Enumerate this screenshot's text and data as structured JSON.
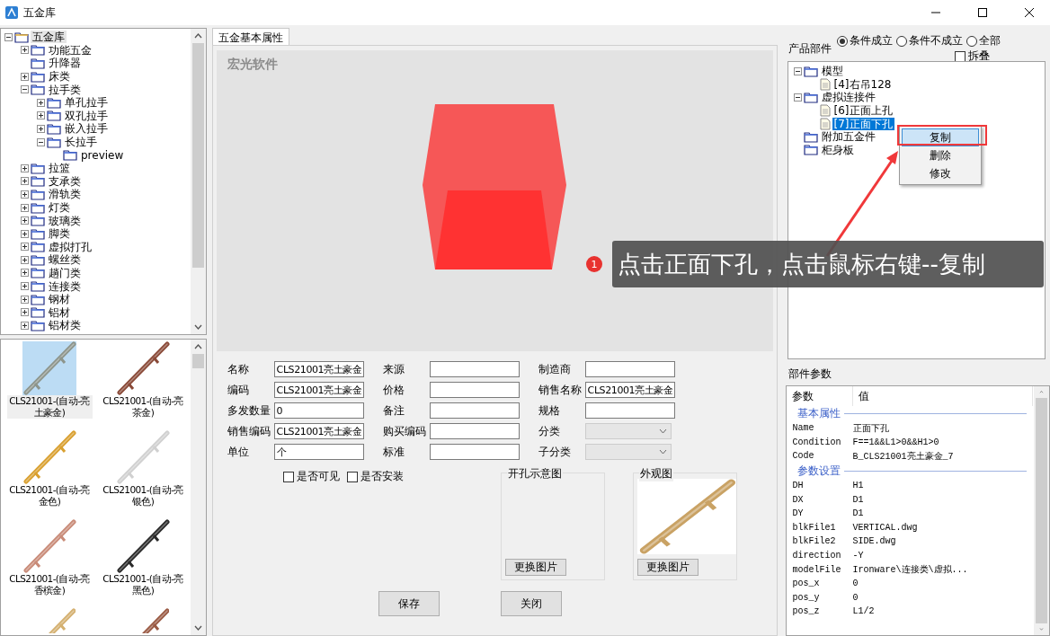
{
  "window": {
    "title": "五金库"
  },
  "category_tree": [
    {
      "label": "五金库",
      "kind": "open-folder",
      "expanded": true,
      "selected": true,
      "children": [
        {
          "label": "功能五金",
          "kind": "folder",
          "expanded": false,
          "selected": false
        },
        {
          "label": "升降器",
          "kind": "folder",
          "selected": false
        },
        {
          "label": "床类",
          "kind": "folder",
          "expanded": false,
          "selected": false
        },
        {
          "label": "拉手类",
          "kind": "folder",
          "expanded": true,
          "selected": false,
          "children": [
            {
              "label": "单孔拉手",
              "kind": "folder",
              "expanded": false,
              "selected": false
            },
            {
              "label": "双孔拉手",
              "kind": "folder",
              "expanded": false,
              "selected": false
            },
            {
              "label": "嵌入拉手",
              "kind": "folder",
              "expanded": false,
              "selected": false
            },
            {
              "label": "长拉手",
              "kind": "folder",
              "expanded": true,
              "selected": false,
              "children": [
                {
                  "label": "preview",
                  "kind": "folder",
                  "selected": false
                }
              ]
            }
          ]
        },
        {
          "label": "拉篮",
          "kind": "folder",
          "expanded": false,
          "selected": false
        },
        {
          "label": "支承类",
          "kind": "folder",
          "expanded": false,
          "selected": false
        },
        {
          "label": "滑轨类",
          "kind": "folder",
          "expanded": false,
          "selected": false
        },
        {
          "label": "灯类",
          "kind": "folder",
          "expanded": false,
          "selected": false
        },
        {
          "label": "玻璃类",
          "kind": "folder",
          "expanded": false,
          "selected": false
        },
        {
          "label": "脚类",
          "kind": "folder",
          "expanded": false,
          "selected": false
        },
        {
          "label": "虚拟打孔",
          "kind": "folder",
          "expanded": false,
          "selected": false
        },
        {
          "label": "螺丝类",
          "kind": "folder",
          "expanded": false,
          "selected": false
        },
        {
          "label": "趟门类",
          "kind": "folder",
          "expanded": false,
          "selected": false
        },
        {
          "label": "连接类",
          "kind": "folder",
          "expanded": false,
          "selected": false
        },
        {
          "label": "钢材",
          "kind": "folder",
          "expanded": false,
          "selected": false
        },
        {
          "label": "铝材",
          "kind": "folder",
          "expanded": false,
          "selected": false
        },
        {
          "label": "铝材类",
          "kind": "folder",
          "expanded": false,
          "selected": false
        }
      ]
    }
  ],
  "gallery": [
    {
      "caption": "CLS21001-(自动-亮土豪金)",
      "color": "#8d958c",
      "selected": true
    },
    {
      "caption": "CLS21001-(自动-亮茶金)",
      "color": "#8a4a38",
      "selected": false
    },
    {
      "caption": "CLS21001-(自动-亮金色)",
      "color": "#d9a030",
      "selected": false
    },
    {
      "caption": "CLS21001-(自动-亮银色)",
      "color": "#d0d0d0",
      "selected": false
    },
    {
      "caption": "CLS21001-(自动-亮香槟金)",
      "color": "#c98b78",
      "selected": false
    },
    {
      "caption": "CLS21001-(自动-亮黑色)",
      "color": "#2a2a2a",
      "selected": false
    },
    {
      "color": "#d4b070",
      "selected": false
    },
    {
      "color": "#9a5a44",
      "selected": false
    }
  ],
  "tab": {
    "label": "五金基本属性",
    "selected": true
  },
  "preview": {
    "label": "宏光软件"
  },
  "form_columns": [
    [
      {
        "kind": "text",
        "label": "名称",
        "value": "CLS21001亮土豪金"
      },
      {
        "kind": "text",
        "label": "编码",
        "value": "CLS21001亮土豪金"
      },
      {
        "kind": "text",
        "label": "多发数量",
        "value": "0"
      },
      {
        "kind": "text",
        "label": "销售编码",
        "value": "CLS21001亮土豪金"
      },
      {
        "kind": "text",
        "label": "单位",
        "value": "个"
      }
    ],
    [
      {
        "kind": "text",
        "label": "来源"
      },
      {
        "kind": "text",
        "label": "价格"
      },
      {
        "kind": "text",
        "label": "备注"
      },
      {
        "kind": "text",
        "label": "购买编码"
      },
      {
        "kind": "text",
        "label": "标准"
      }
    ],
    [
      {
        "kind": "text",
        "label": "制造商"
      },
      {
        "kind": "text",
        "label": "销售名称",
        "value": "CLS21001亮土豪金"
      },
      {
        "kind": "text",
        "label": "规格"
      },
      {
        "kind": "select",
        "label": "分类",
        "disabled": true
      },
      {
        "kind": "select",
        "label": "子分类",
        "disabled": true
      }
    ]
  ],
  "checkboxes": [
    {
      "label": "是否可见",
      "checked": false
    },
    {
      "label": "是否安装",
      "checked": false
    }
  ],
  "image_groups": [
    {
      "title": "开孔示意图",
      "kind": "empty",
      "button": "更换图片"
    },
    {
      "title": "外观图",
      "kind": "picture",
      "button": "更换图片"
    }
  ],
  "buttons": [
    "保存",
    "关闭"
  ],
  "parts_panel": {
    "label": "产品部件",
    "filters": [
      {
        "label": "条件成立",
        "selected": true
      },
      {
        "label": "条件不成立",
        "selected": false
      },
      {
        "label": "全部",
        "selected": false
      }
    ],
    "collapse": {
      "label": "拆叠",
      "checked": false
    },
    "tree": [
      {
        "label": "模型",
        "kind": "folder",
        "expanded": true,
        "selected": false,
        "children": [
          {
            "label": "[4]右吊128",
            "kind": "document",
            "selected": false
          }
        ]
      },
      {
        "label": "虚拟连接件",
        "kind": "folder",
        "expanded": true,
        "selected": false,
        "children": [
          {
            "label": "[6]正面上孔",
            "kind": "document",
            "selected": false
          },
          {
            "label": "[7]正面下孔",
            "kind": "document",
            "selected": true
          }
        ]
      },
      {
        "label": "附加五金件",
        "kind": "folder",
        "selected": false
      },
      {
        "label": "柜身板",
        "kind": "folder",
        "selected": false
      }
    ]
  },
  "context_menu": [
    {
      "label": "复制",
      "selected": true
    },
    {
      "label": "删除",
      "selected": false
    },
    {
      "label": "修改",
      "selected": false
    }
  ],
  "params_panel": {
    "label": "部件参数",
    "columns": [
      "参数",
      "值"
    ],
    "sections": [
      {
        "title": "基本属性",
        "rows": [
          {
            "name": "Name",
            "value": "正面下孔"
          },
          {
            "name": "Condition",
            "value": "F==1&&L1>0&&H1>0"
          },
          {
            "name": "Code",
            "value": "B_CLS21001亮土豪金_7"
          }
        ]
      },
      {
        "title": "参数设置",
        "rows": [
          {
            "name": "DH",
            "value": "H1"
          },
          {
            "name": "DX",
            "value": "D1"
          },
          {
            "name": "DY",
            "value": "D1"
          },
          {
            "name": "blkFile1",
            "value": "VERTICAL.dwg"
          },
          {
            "name": "blkFile2",
            "value": "SIDE.dwg"
          },
          {
            "name": "direction",
            "value": "-Y"
          },
          {
            "name": "modelFile",
            "value": "Ironware\\连接类\\虚拟..."
          },
          {
            "name": "pos_x",
            "value": "0"
          },
          {
            "name": "pos_y",
            "value": "0"
          },
          {
            "name": "pos_z",
            "value": "L1/2"
          }
        ]
      }
    ]
  },
  "callout": {
    "number": "1",
    "text": "点击正面下孔，点击鼠标右键--复制"
  }
}
